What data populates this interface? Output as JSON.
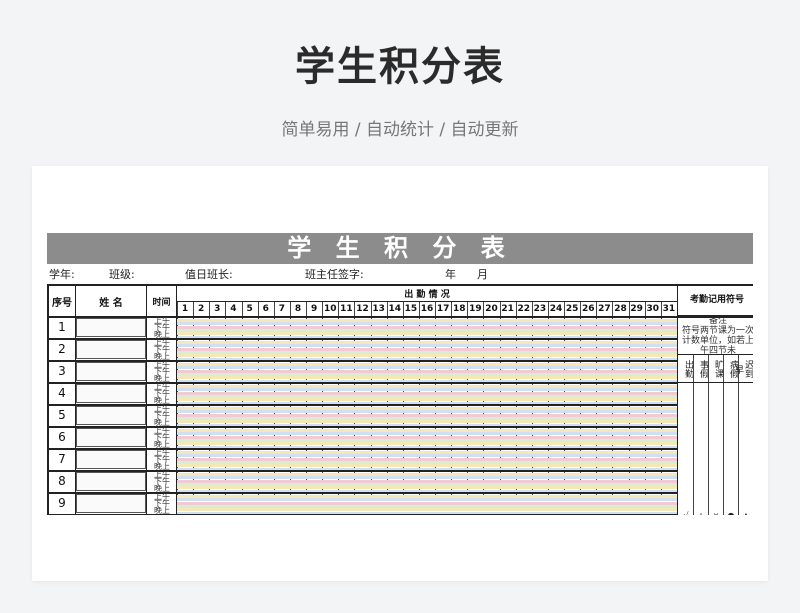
{
  "hero": {
    "title": "学生积分表",
    "subtitle": "简单易用 / 自动统计 / 自动更新"
  },
  "sheet": {
    "banner": "学 生 积 分 表",
    "info": {
      "year": "学年:",
      "class": "班级:",
      "monitor": "值日班长:",
      "teacher_sign": "班主任签字:",
      "year_label": "年",
      "month_label": "月"
    },
    "headers": {
      "seq": "序号",
      "name": "姓 名",
      "time": "时间",
      "attendance": "出 勤 情 况",
      "legend": "考勤记用符号"
    },
    "days": [
      "1",
      "2",
      "3",
      "4",
      "5",
      "6",
      "7",
      "8",
      "9",
      "10",
      "11",
      "12",
      "13",
      "14",
      "15",
      "16",
      "17",
      "18",
      "19",
      "20",
      "21",
      "22",
      "23",
      "24",
      "25",
      "26",
      "27",
      "28",
      "29",
      "30",
      "31"
    ],
    "rows": [
      "1",
      "2",
      "3",
      "4",
      "5",
      "6",
      "7",
      "8",
      "9"
    ],
    "sessions": [
      "上午",
      "下午",
      "晚上"
    ],
    "legend": {
      "note_title": "备注",
      "note": "符号两节课为一次计数单位，如若上午四节未",
      "columns": [
        "出勤",
        "事假",
        "旷课",
        "病假",
        "迟到早"
      ],
      "symbols": [
        "√",
        "△",
        "×",
        "●",
        "▲"
      ]
    },
    "stripe_colors": [
      "#f6e7b8",
      "#cfe0f4",
      "#f3c9d4",
      "#d6efd1"
    ]
  }
}
